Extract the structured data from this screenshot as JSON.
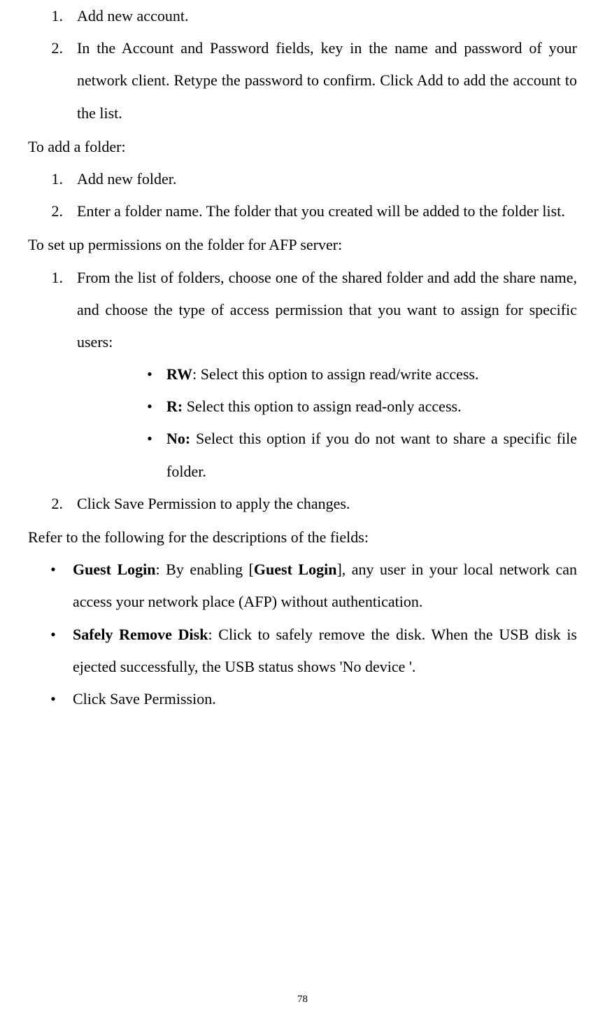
{
  "list_a": [
    {
      "n": "1.",
      "text": "Add new account."
    },
    {
      "n": "2.",
      "text": "In the Account and Password fields, key in the name and password of your network client. Retype the password to confirm. Click Add to add the account to the list."
    }
  ],
  "heading_b": "To add a folder:",
  "list_b": [
    {
      "n": "1.",
      "text": "Add new folder."
    },
    {
      "n": "2.",
      "text": "Enter a folder name. The folder that you created will be added to the folder list."
    }
  ],
  "heading_c": "To set up permissions on the folder for AFP server:",
  "list_c1_n": "1.",
  "list_c1_text": "From the list of folders, choose one of the shared folder and add the share name, and choose the type of access permission that you want to assign for specific users:",
  "list_c1_sub": [
    {
      "bold": "RW",
      "sep": ": ",
      "rest": "Select this option to assign read/write access."
    },
    {
      "bold": "R:",
      "sep": " ",
      "rest": "Select this option to assign read-only access."
    },
    {
      "bold": "No:",
      "sep": " ",
      "rest": "Select this option if you do not want to share a specific file folder."
    }
  ],
  "list_c2_n": "2.",
  "list_c2_text": "Click Save Permission to apply the changes.",
  "heading_d": "Refer to the following for the descriptions of the fields:",
  "list_d": [
    {
      "bold1": "Guest Login",
      "mid": ": By enabling [",
      "bold2": "Guest Login",
      "rest": "], any user in your local network can access your network place (AFP) without authentication."
    },
    {
      "bold1": "Safely Remove Disk",
      "mid": ": Click to safely remove the disk. When the USB disk is ejected successfully, the USB status shows 'No device '.",
      "bold2": "",
      "rest": ""
    },
    {
      "bold1": "",
      "mid": "Click Save Permission.",
      "bold2": "",
      "rest": ""
    }
  ],
  "page_number": "78",
  "bullet_char": "•"
}
